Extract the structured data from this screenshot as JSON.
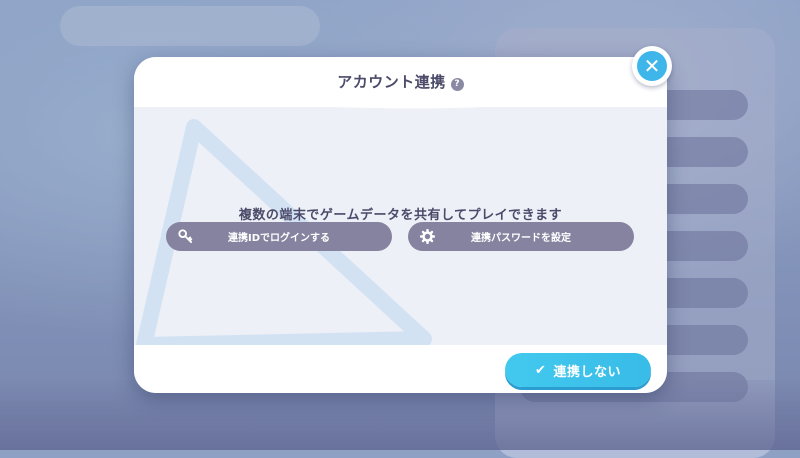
{
  "dialog": {
    "title": "アカウント連携",
    "help_icon": "question-mark-icon",
    "description": "複数の端末でゲームデータを共有してプレイできます",
    "options": [
      {
        "label": "連携IDでログインする",
        "icon": "key-icon"
      },
      {
        "label": "連携パスワードを設定",
        "icon": "gear-icon"
      }
    ],
    "skip_label": "連携しない",
    "skip_icon": "checkmark-icon",
    "close_icon": "close-icon"
  },
  "colors": {
    "accent": "#3fb6ea",
    "title_text": "#4b4a69",
    "option_button": "#85839f"
  }
}
